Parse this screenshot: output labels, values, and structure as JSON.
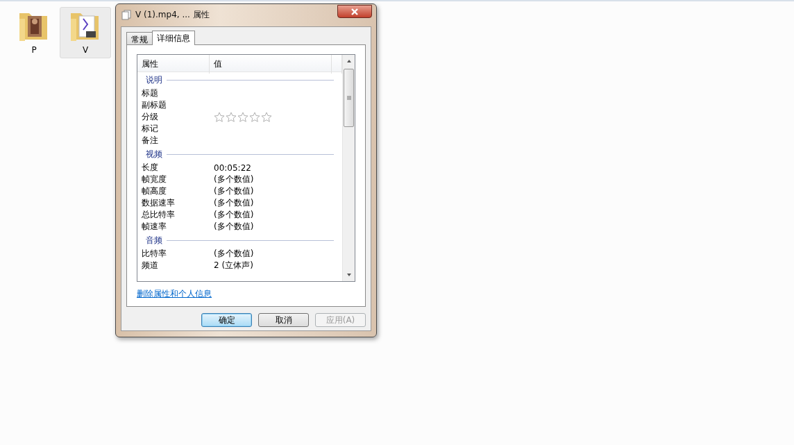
{
  "desktop_icons": [
    {
      "label": "P",
      "kind": "photo",
      "selected": false
    },
    {
      "label": "V",
      "kind": "video",
      "selected": true
    }
  ],
  "window": {
    "title": "V (1).mp4, ... 属性"
  },
  "tabs": [
    {
      "label": "常规",
      "selected": false
    },
    {
      "label": "详细信息",
      "selected": true
    }
  ],
  "table": {
    "columns": [
      "属性",
      "值"
    ],
    "sections": [
      {
        "title": "说明",
        "rows": [
          {
            "kind": "text",
            "name": "标题"
          },
          {
            "kind": "text",
            "name": "副标题"
          },
          {
            "kind": "rating",
            "name": "分级",
            "stars": 0
          },
          {
            "kind": "text",
            "name": "标记"
          },
          {
            "kind": "text",
            "name": "备注"
          }
        ]
      },
      {
        "title": "视频",
        "rows": [
          {
            "kind": "text",
            "name": "长度",
            "value": "00:05:22"
          },
          {
            "kind": "text",
            "name": "帧宽度",
            "value": "(多个数值)"
          },
          {
            "kind": "text",
            "name": "帧高度",
            "value": "(多个数值)"
          },
          {
            "kind": "text",
            "name": "数据速率",
            "value": "(多个数值)"
          },
          {
            "kind": "text",
            "name": "总比特率",
            "value": "(多个数值)"
          },
          {
            "kind": "text",
            "name": "帧速率",
            "value": "(多个数值)"
          }
        ]
      },
      {
        "title": "音频",
        "rows": [
          {
            "kind": "text",
            "name": "比特率",
            "value": "(多个数值)"
          },
          {
            "kind": "text",
            "name": "频道",
            "value": "2 (立体声)"
          }
        ]
      }
    ]
  },
  "link": "删除属性和个人信息",
  "buttons": [
    {
      "label": "确定",
      "default": true,
      "disabled": false
    },
    {
      "label": "取消",
      "default": false,
      "disabled": false
    },
    {
      "label": "应用(A)",
      "default": false,
      "disabled": true
    }
  ]
}
